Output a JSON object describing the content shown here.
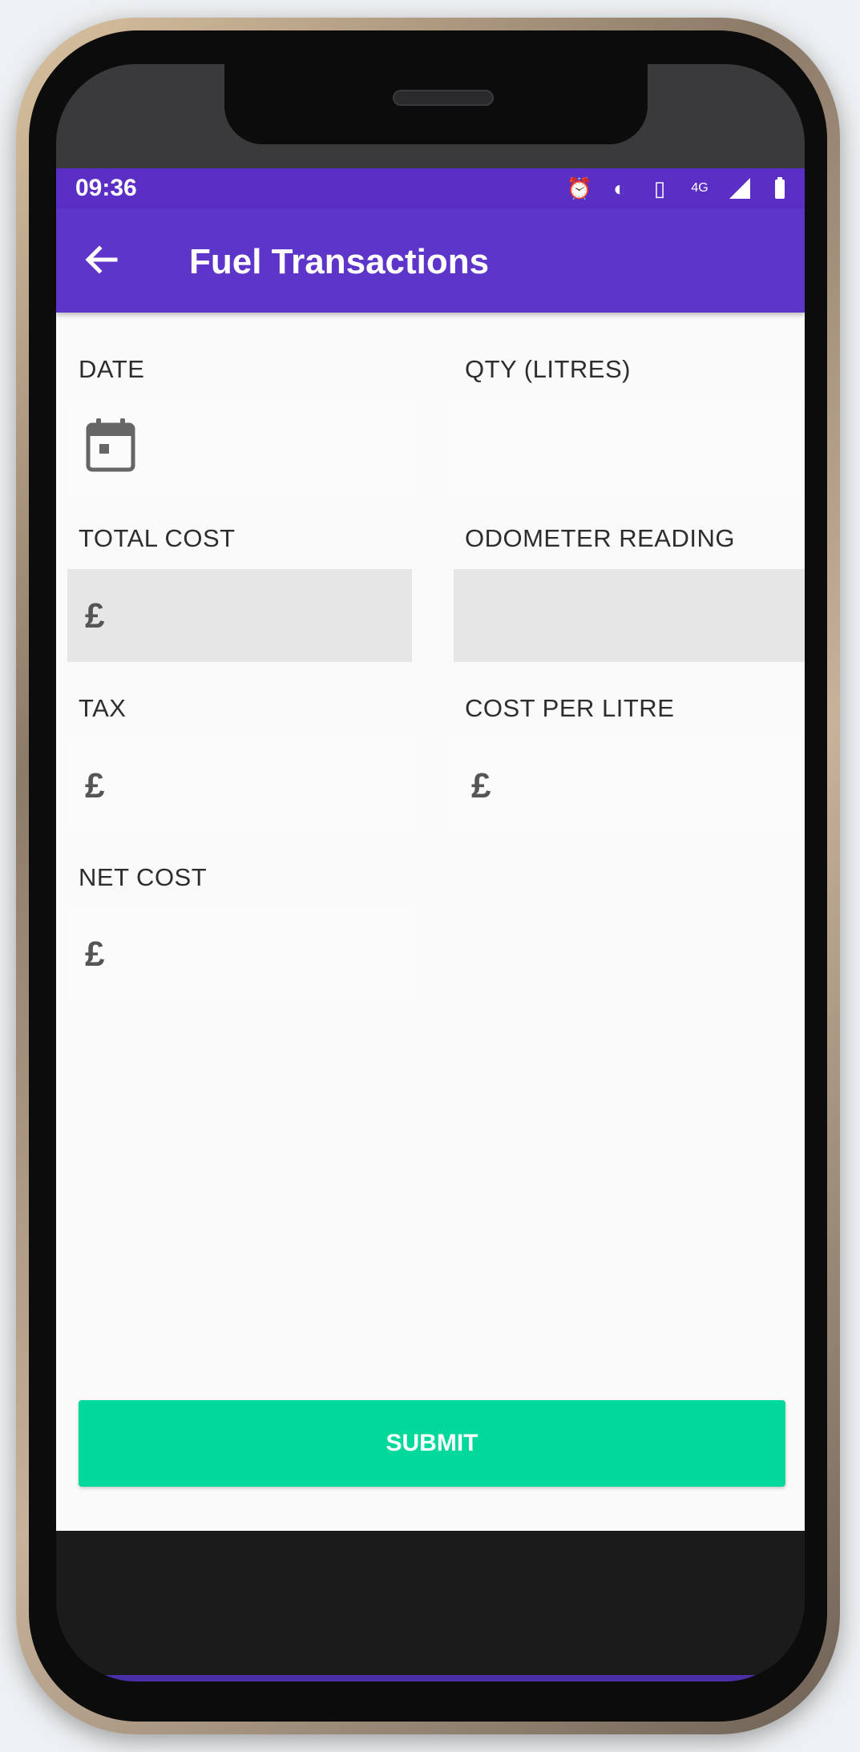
{
  "status": {
    "time": "09:36",
    "icons": [
      "alarm-icon",
      "data-saver-icon",
      "vibrate-icon",
      "4g-icon",
      "signal-icon",
      "battery-icon"
    ]
  },
  "appbar": {
    "title": "Fuel Transactions",
    "back_icon": "arrow-back-icon"
  },
  "form": {
    "date": {
      "label": "DATE",
      "value": ""
    },
    "qty": {
      "label": "QTY (LITRES)",
      "value": ""
    },
    "total_cost": {
      "label": "TOTAL COST",
      "currency": "£",
      "value": ""
    },
    "odometer": {
      "label": "ODOMETER READING",
      "value": ""
    },
    "tax": {
      "label": "TAX",
      "currency": "£",
      "value": ""
    },
    "cost_per_litre": {
      "label": "COST PER LITRE",
      "currency": "£",
      "value": ""
    },
    "net_cost": {
      "label": "NET COST",
      "currency": "£",
      "value": ""
    }
  },
  "submit_label": "SUBMIT",
  "colors": {
    "primary": "#5e35c9",
    "status_bar": "#5b2fc6",
    "accent": "#00d99b",
    "disabled_field": "#e6e6e6"
  }
}
